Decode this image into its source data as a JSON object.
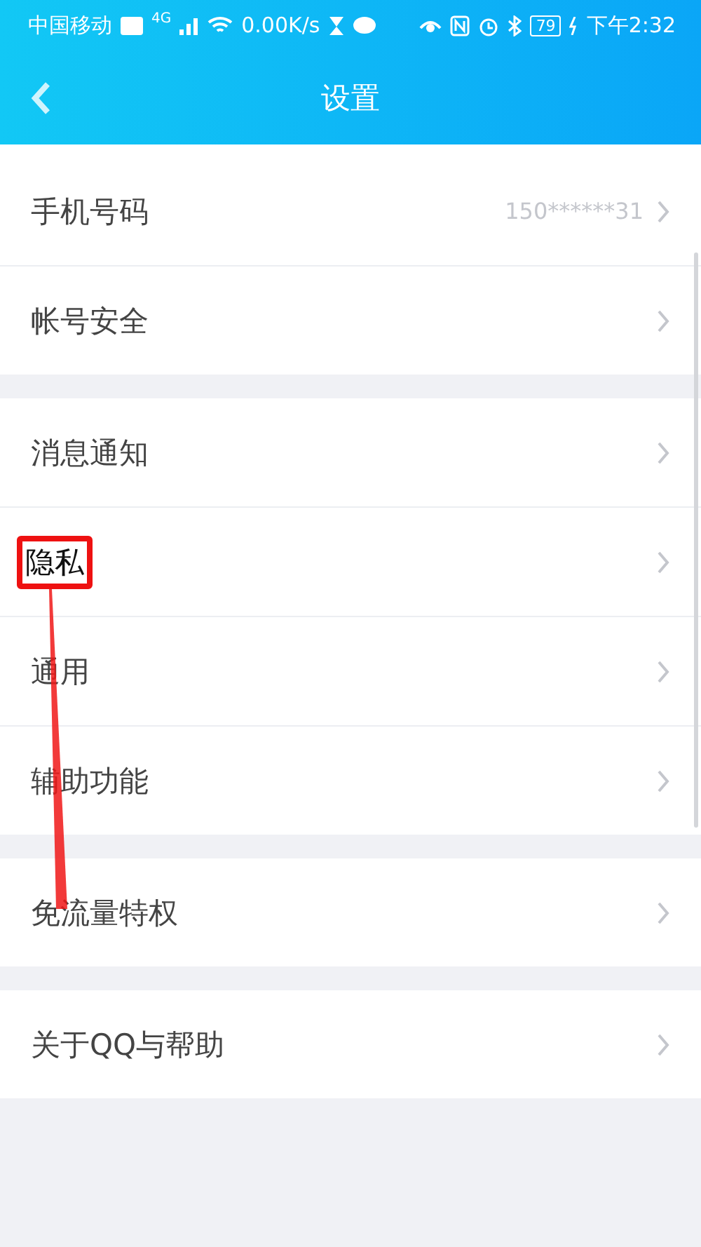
{
  "status_bar": {
    "carrier": "中国移动",
    "network": "4G",
    "speed": "0.00K/s",
    "battery": "79",
    "time": "下午2:32"
  },
  "nav": {
    "title": "设置"
  },
  "groups": [
    {
      "items": [
        {
          "label": "手机号码",
          "value": "150******31",
          "highlighted": false
        },
        {
          "label": "帐号安全",
          "highlighted": false
        }
      ]
    },
    {
      "items": [
        {
          "label": "消息通知",
          "highlighted": false
        },
        {
          "label": "隐私",
          "highlighted": true
        },
        {
          "label": "通用",
          "highlighted": false
        },
        {
          "label": "辅助功能",
          "highlighted": false
        }
      ]
    },
    {
      "items": [
        {
          "label": "免流量特权",
          "highlighted": false
        }
      ]
    },
    {
      "items": [
        {
          "label": "关于QQ与帮助",
          "highlighted": false
        }
      ]
    }
  ]
}
